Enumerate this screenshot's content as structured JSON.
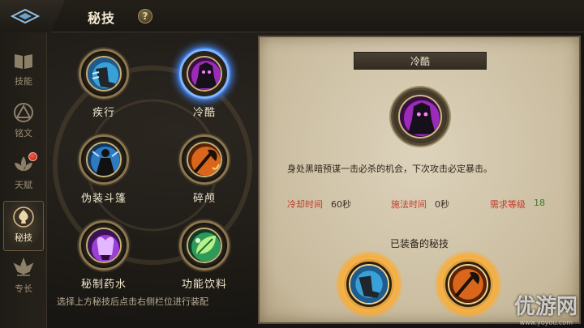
{
  "header": {
    "title": "秘技",
    "help_label": "?"
  },
  "nav": {
    "items": [
      {
        "label": "技能",
        "icon": "book-icon",
        "active": false
      },
      {
        "label": "铭文",
        "icon": "rune-triangle-icon",
        "active": false
      },
      {
        "label": "天赋",
        "icon": "lotus-icon",
        "active": false,
        "badge": true
      },
      {
        "label": "秘技",
        "icon": "spade-emblem-icon",
        "active": true
      },
      {
        "label": "专长",
        "icon": "lotus-emblem-icon",
        "active": false
      }
    ]
  },
  "skills": [
    {
      "name": "疾行",
      "icon": "dash-boot-icon",
      "selected": false
    },
    {
      "name": "冷酷",
      "icon": "dark-shadow-icon",
      "selected": true
    },
    {
      "name": "伪装斗篷",
      "icon": "cloak-figure-icon",
      "selected": false
    },
    {
      "name": "碎颅",
      "icon": "axe-strike-icon",
      "selected": false
    },
    {
      "name": "秘制药水",
      "icon": "purple-potion-icon",
      "selected": false
    },
    {
      "name": "功能饮料",
      "icon": "green-leaf-icon",
      "selected": false
    }
  ],
  "hint": "选择上方秘技后点击右侧栏位进行装配",
  "detail": {
    "title": "冷酷",
    "description": "身处黑暗预谋一击必杀的机会，下次攻击必定暴击。",
    "cooldown_label": "冷却时间",
    "cooldown_value": "60秒",
    "cast_label": "施法时间",
    "cast_value": "0秒",
    "level_label": "需求等级",
    "level_value": "18",
    "equipped_label": "已装备的秘技"
  },
  "watermark": {
    "brand": "优游网",
    "url": "www.yoyou.com"
  },
  "colors": {
    "accent_red": "#c43b2a",
    "accent_green": "#3b7a29",
    "selected_glow": "#4c8fff",
    "slot_glow": "#ffb040"
  }
}
